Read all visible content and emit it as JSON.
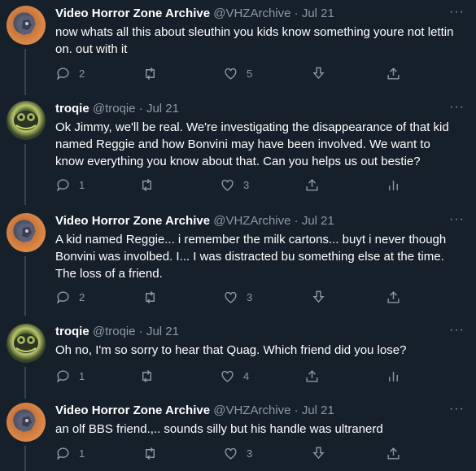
{
  "tweets": [
    {
      "name": "Video Horror Zone Archive",
      "handle": "@VHZArchive",
      "time": "Jul 21",
      "text": "now whats all this about sleuthin you kids know something youre not lettin on. out with it",
      "replies": "2",
      "retweets": "",
      "likes": "5",
      "avatar": "vhz-avatar"
    },
    {
      "name": "troqie",
      "handle": "@troqie",
      "time": "Jul 21",
      "text": "Ok Jimmy, we'll be real. We're investigating the disappearance of that kid named Reggie and how Bonvini may have been involved. We want to know everything you know about that. Can you helps us out bestie?",
      "replies": "1",
      "retweets": "",
      "likes": "3",
      "avatar": "troqie-avatar"
    },
    {
      "name": "Video Horror Zone Archive",
      "handle": "@VHZArchive",
      "time": "Jul 21",
      "text": "A kid named Reggie... i remember the milk cartons... buyt i never though Bonvini was involbed. I... I was distracted bu something else at the time. The loss of a friend.",
      "replies": "2",
      "retweets": "",
      "likes": "3",
      "avatar": "vhz-avatar"
    },
    {
      "name": "troqie",
      "handle": "@troqie",
      "time": "Jul 21",
      "text": "Oh no, I'm so sorry to hear that Quag. Which friend did you lose?",
      "replies": "1",
      "retweets": "",
      "likes": "4",
      "avatar": "troqie-avatar"
    },
    {
      "name": "Video Horror Zone Archive",
      "handle": "@VHZArchive",
      "time": "Jul 21",
      "text": "an olf BBS friend.,.. sounds silly but his handle was ultranerd",
      "replies": "1",
      "retweets": "",
      "likes": "3",
      "avatar": "vhz-avatar"
    }
  ],
  "separator": "·",
  "more_glyph": "···",
  "colors": {
    "background": "#15202b",
    "name": "#ffffff",
    "muted": "#8b98a5",
    "thread_line": "#38444d"
  },
  "icons": [
    "reply-icon",
    "retweet-icon",
    "like-icon",
    "download-icon",
    "share-icon",
    "analytics-icon",
    "more-icon"
  ]
}
